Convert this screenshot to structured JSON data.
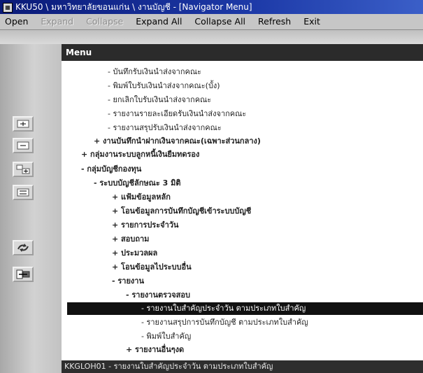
{
  "window": {
    "title": "KKU50 \\ มหาวิทยาลัยขอนแก่น \\ งานบัญชี - [Navigator Menu]"
  },
  "menubar": [
    {
      "label": "Open",
      "enabled": true
    },
    {
      "label": "Expand",
      "enabled": false
    },
    {
      "label": "Collapse",
      "enabled": false
    },
    {
      "label": "Expand All",
      "enabled": true
    },
    {
      "label": "Collapse All",
      "enabled": true
    },
    {
      "label": "Refresh",
      "enabled": true
    },
    {
      "label": "Exit",
      "enabled": true
    }
  ],
  "panel": {
    "title": "Menu"
  },
  "sidebar_buttons": [
    {
      "icon": "expand-icon"
    },
    {
      "icon": "collapse-icon"
    },
    {
      "icon": "expand-all-icon"
    },
    {
      "icon": "collapse-all-icon"
    },
    {
      "icon": "refresh-icon"
    },
    {
      "icon": "exit-icon"
    }
  ],
  "tree": [
    {
      "label": "- บันทึกรับเงินนำส่งจากคณะ",
      "level": 3,
      "selected": false
    },
    {
      "label": "- พิมพ์ใบรับเงินนำส่งจากคณะ(บั้ง)",
      "level": 3,
      "selected": false
    },
    {
      "label": "- ยกเลิกใบรับเงินนำส่งจากคณะ",
      "level": 3,
      "selected": false
    },
    {
      "label": "- รายงานรายละเอียดรับเงินนำส่งจากคณะ",
      "level": 3,
      "selected": false
    },
    {
      "label": "- รายงานสรุปรับเงินนำส่งจากคณะ",
      "level": 3,
      "selected": false
    },
    {
      "label": "+ งานบันทึกนำฝากเงินจากคณะ(เฉพาะส่วนกลาง)",
      "level": 2,
      "selected": false
    },
    {
      "label": "+ กลุ่มงานระบบลูกหนี้เงินยืมทดรอง",
      "level": 1,
      "selected": false
    },
    {
      "label": "- กลุ่มบัญชีกองทุน",
      "level": 1,
      "selected": false
    },
    {
      "label": "- ระบบบัญชีลักษณะ 3 มิติ",
      "level": 2,
      "selected": false
    },
    {
      "label": "+ แฟ้มข้อมูลหลัก",
      "level": 3,
      "selected": false
    },
    {
      "label": "+ โอนข้อมูลการบันทึกบัญชีเข้าระบบบัญชี",
      "level": 3,
      "selected": false
    },
    {
      "label": "+ รายการประจำวัน",
      "level": 3,
      "selected": false
    },
    {
      "label": "+ สอบถาม",
      "level": 3,
      "selected": false
    },
    {
      "label": "+ ประมวลผล",
      "level": 3,
      "selected": false
    },
    {
      "label": "+ โอนข้อมูลไประบบอื่น",
      "level": 3,
      "selected": false
    },
    {
      "label": "- รายงาน",
      "level": 3,
      "selected": false
    },
    {
      "label": "- รายงานตรวจสอบ",
      "level": 4,
      "selected": false
    },
    {
      "label": "- รายงานใบสำคัญประจำวัน ตามประเภทใบสำคัญ",
      "level": 5,
      "selected": true
    },
    {
      "label": "- รายงานสรุปการบันทึกบัญชี ตามประเภทใบสำคัญ",
      "level": 5,
      "selected": false
    },
    {
      "label": "- พิมพ์ใบสำคัญ",
      "level": 5,
      "selected": false
    },
    {
      "label": "+ รายงานอื่นๆงด",
      "level": 4,
      "selected": false
    }
  ],
  "statusbar": {
    "text": "KKGLOH01 - รายงานใบสำคัญประจำวัน ตามประเภทใบสำคัญ"
  }
}
